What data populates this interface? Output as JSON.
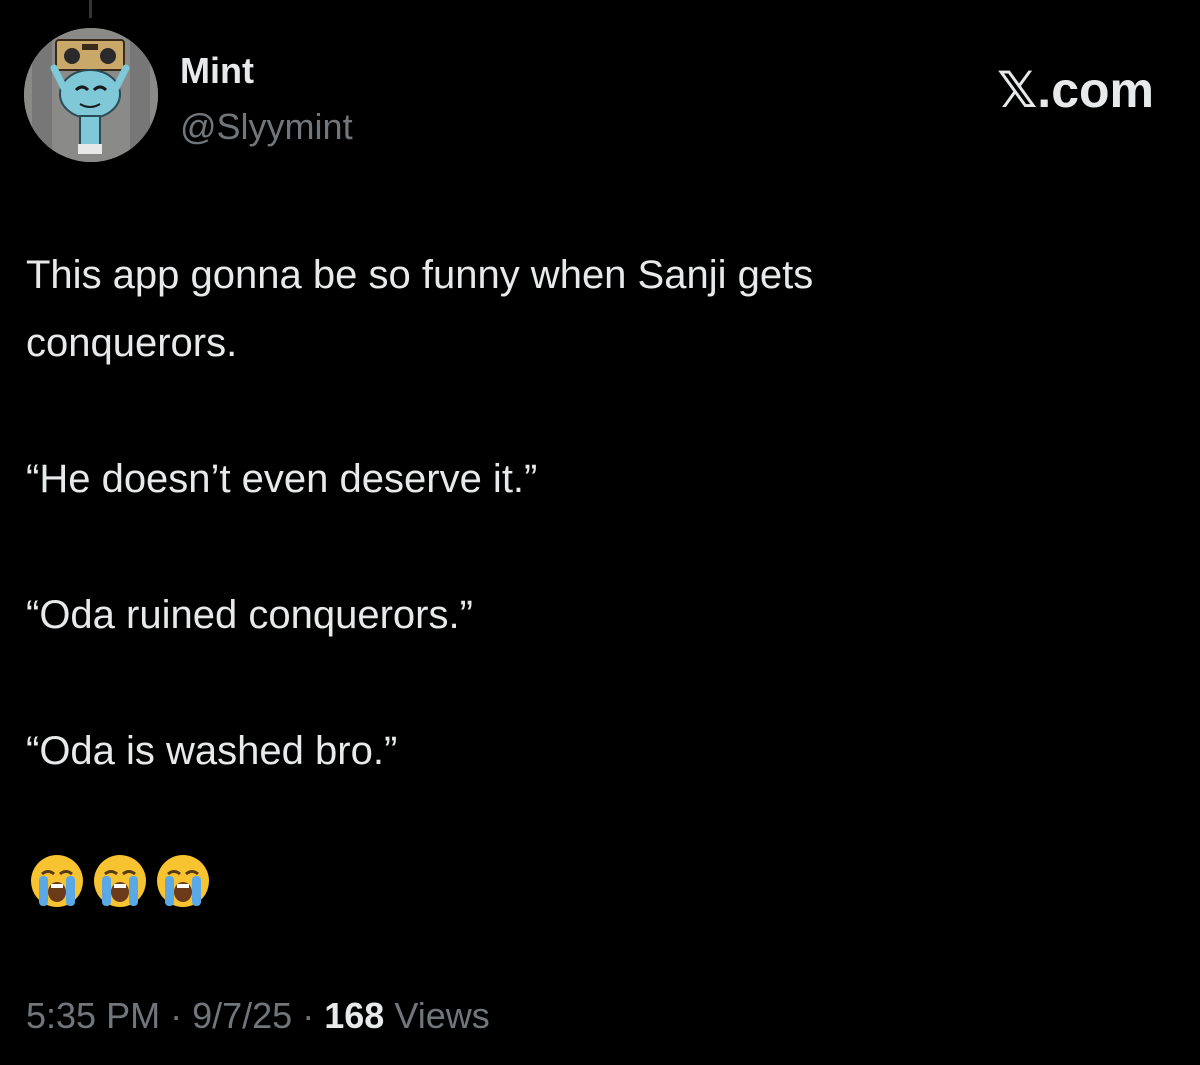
{
  "tweet": {
    "display_name": "Mint",
    "handle": "@Slyymint",
    "avatar_icon": "cartoon-character-avatar-icon",
    "lines": [
      "This app gonna be so funny when Sanji gets",
      "conquerors.",
      "“He doesn’t even deserve it.”",
      "“Oda ruined conquerors.”",
      "“Oda is washed bro.”"
    ],
    "emojis": [
      "loudly-crying-face-icon",
      "loudly-crying-face-icon",
      "loudly-crying-face-icon"
    ],
    "time": "5:35 PM",
    "date": "9/7/25",
    "views_count": "168",
    "views_label": "Views",
    "separator": "·"
  },
  "brand": {
    "x_logo": "𝕏",
    "domain_suffix": ".com"
  },
  "colors": {
    "background": "#000000",
    "primary_text": "#e7e9ea",
    "secondary_text": "#71767b"
  }
}
